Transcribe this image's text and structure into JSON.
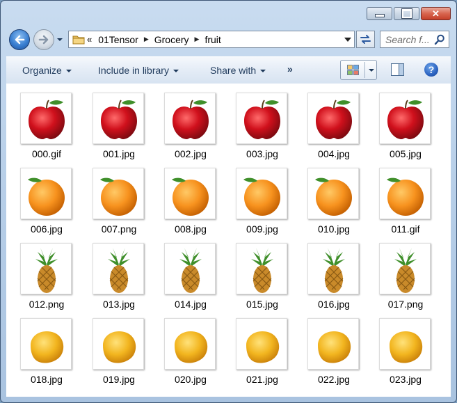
{
  "window": {
    "buttons": {
      "minimize": "minimize",
      "maximize": "maximize",
      "close": "close"
    }
  },
  "address": {
    "lead": "«",
    "crumbs": [
      "01Tensor",
      "Grocery",
      "fruit"
    ]
  },
  "search": {
    "placeholder": "Search f..."
  },
  "toolbar": {
    "organize": "Organize",
    "include": "Include in library",
    "share": "Share with",
    "more": "»"
  },
  "help": {
    "label": "?"
  },
  "files": [
    {
      "name": "000.gif",
      "kind": "apple"
    },
    {
      "name": "001.jpg",
      "kind": "apple"
    },
    {
      "name": "002.jpg",
      "kind": "apple"
    },
    {
      "name": "003.jpg",
      "kind": "apple"
    },
    {
      "name": "004.jpg",
      "kind": "apple"
    },
    {
      "name": "005.jpg",
      "kind": "apple"
    },
    {
      "name": "006.jpg",
      "kind": "orange"
    },
    {
      "name": "007.png",
      "kind": "orange"
    },
    {
      "name": "008.jpg",
      "kind": "orange"
    },
    {
      "name": "009.jpg",
      "kind": "orange"
    },
    {
      "name": "010.jpg",
      "kind": "orange"
    },
    {
      "name": "011.gif",
      "kind": "orange"
    },
    {
      "name": "012.png",
      "kind": "pineapple"
    },
    {
      "name": "013.jpg",
      "kind": "pineapple"
    },
    {
      "name": "014.jpg",
      "kind": "pineapple"
    },
    {
      "name": "015.jpg",
      "kind": "pineapple"
    },
    {
      "name": "016.jpg",
      "kind": "pineapple"
    },
    {
      "name": "017.png",
      "kind": "pineapple"
    },
    {
      "name": "018.jpg",
      "kind": "mango"
    },
    {
      "name": "019.jpg",
      "kind": "mango"
    },
    {
      "name": "020.jpg",
      "kind": "mango"
    },
    {
      "name": "021.jpg",
      "kind": "mango"
    },
    {
      "name": "022.jpg",
      "kind": "mango"
    },
    {
      "name": "023.jpg",
      "kind": "mango"
    }
  ],
  "colors": {
    "apple": "#d0101c",
    "orange": "#f7921e",
    "pineapple": "#c98a2a",
    "mango": "#f2b51f",
    "leaf": "#3f8f2a"
  }
}
